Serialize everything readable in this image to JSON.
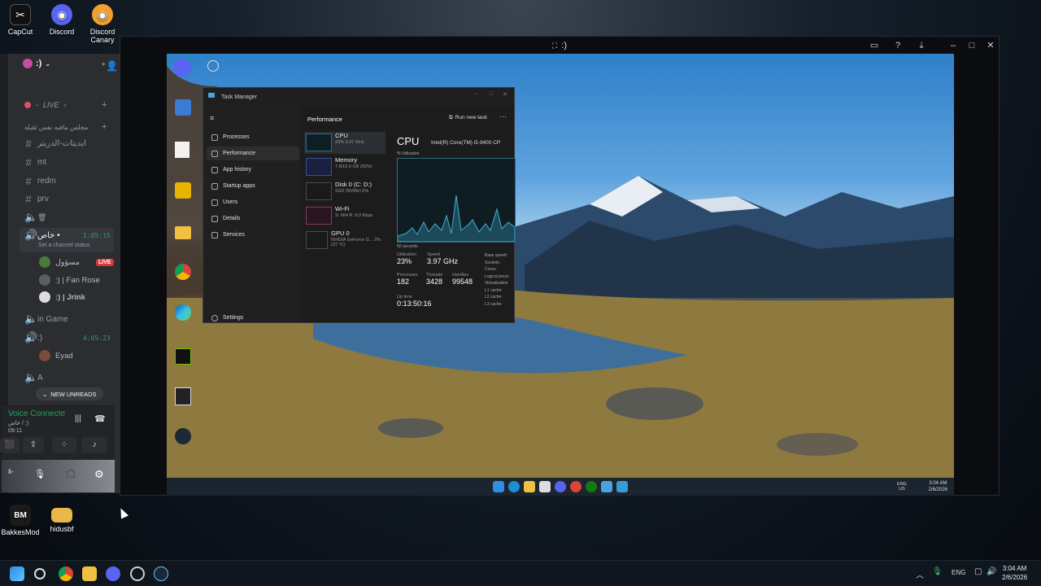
{
  "desktop_icons": [
    {
      "label": "CapCut",
      "glyph": "✂",
      "color": "#111111"
    },
    {
      "label": "Discord",
      "glyph": "◉",
      "color": "#5865f2"
    },
    {
      "label": "Discord Canary",
      "glyph": "◉",
      "color": "#f0a030"
    },
    {
      "label": "BakkesMod",
      "glyph": "BM",
      "color": "#1b1b1b"
    },
    {
      "label": "hidusbf",
      "glyph": "▬",
      "color": "#e8b84a"
    }
  ],
  "stream": {
    "title": ":)"
  },
  "discord": {
    "server_name": ":)",
    "categories": {
      "live": "LIVE",
      "arabic_category": "مجلس مافيه نفس ثقيله"
    },
    "channels": [
      {
        "name": "ابديتات-الدريتر",
        "type": "text"
      },
      {
        "name": "mt",
        "type": "text"
      },
      {
        "name": "redm",
        "type": "text"
      },
      {
        "name": "prv",
        "type": "text"
      }
    ],
    "voice_channels": [
      {
        "name": "خاص •",
        "timer": "1:05:15",
        "status_hint": "Set a channel status"
      },
      {
        "name": "in Game",
        "timer": ""
      },
      {
        "name": ":)",
        "timer": "4:05:23"
      },
      {
        "name": "A",
        "timer": ""
      }
    ],
    "users": [
      {
        "name": "مسؤول",
        "badge": "LIVE"
      },
      {
        "name": ":) | Fan Rose",
        "badge": ""
      },
      {
        "name": ":) | Jrink",
        "badge": ""
      },
      {
        "name": "Eyad",
        "badge": ""
      }
    ],
    "new_unreads": "NEW UNREADS",
    "voice": {
      "status": "Voice Connecte",
      "channel": "خاص / :)",
      "time": "09:11"
    }
  },
  "task_manager": {
    "title": "Task Manager",
    "section": "Performance",
    "run_new_task": "Run new task",
    "nav": [
      "Processes",
      "Performance",
      "App history",
      "Startup apps",
      "Users",
      "Details",
      "Services"
    ],
    "settings": "Settings",
    "perf_items": [
      {
        "name": "CPU",
        "sub": "23% 3.97 GHz"
      },
      {
        "name": "Memory",
        "sub": "7.8/15.9 GB (50%)"
      },
      {
        "name": "Disk 0 (C: D:)",
        "sub": "SSD (NVMe) 0%"
      },
      {
        "name": "Wi-Fi",
        "sub": "S: 664 R: 8.0 Kbps"
      },
      {
        "name": "GPU 0",
        "sub": "NVIDIA GeForce G... 2% (37 °C)"
      }
    ],
    "cpu": {
      "heading": "CPU",
      "model": "Intel(R) Core(TM) i5-9400 CP",
      "graph_label": "% Utilization",
      "graph_footer": "60 seconds",
      "utilization_label": "Utilization",
      "utilization": "23%",
      "speed_label": "Speed",
      "speed": "3.97 GHz",
      "processes_label": "Processes",
      "processes": "182",
      "threads_label": "Threads",
      "threads": "3428",
      "handles_label": "Handles",
      "handles": "99548",
      "uptime_label": "Up time",
      "uptime": "0:13:50:16",
      "specs": [
        "Base speed:",
        "Sockets:",
        "Cores:",
        "Logical proce",
        "Virtualization",
        "L1 cache:",
        "L2 cache:",
        "L3 cache:"
      ]
    }
  },
  "remote_desktop_icons": [
    "Discord",
    "Revo Uninstall",
    "New Text Document",
    "Rockstar",
    "Folder",
    "Google Chrome",
    "Microsoft Edge",
    "NVIDIA App",
    "Epic Games",
    "Steam"
  ],
  "inner_tray": {
    "lang": "ENG US",
    "time": "3:04 AM",
    "date": "2/6/2026"
  },
  "tray": {
    "lang": "ENG",
    "time": "3:04 AM",
    "date": "2/6/2026"
  }
}
